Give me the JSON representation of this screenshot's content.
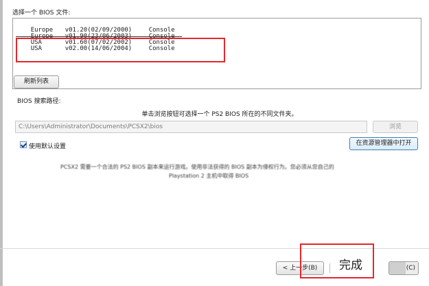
{
  "window": {
    "section_label": "选择一个 BIOS 文件:",
    "bios_list": [
      {
        "region": "Europe",
        "version": "v01.20(02/09/2000)",
        "type": "Console"
      },
      {
        "region": "Europe",
        "version": "v01.90(23/06/2003)",
        "type": "Console"
      },
      {
        "region": "USA",
        "version": "v01.60(07/02/2002)",
        "type": "Console"
      },
      {
        "region": "USA",
        "version": "v02.00(14/06/2004)",
        "type": "Console"
      }
    ],
    "refresh_button": "刷新列表",
    "search_path_label": "BIOS 搜索路径:",
    "browse_hint": "单击浏览按钮可选择一个 PS2 BIOS 所在的不同文件夹。",
    "path_value": "C:\\Users\\Administrator\\Documents\\PCSX2\\bios",
    "browse_button": "浏览",
    "use_default_label": "使用默认设置",
    "use_default_checked": true,
    "open_explorer_button": "在资源管理器中打开",
    "notice_line1": "PCSX2 需要一个合法的 PS2 BIOS 副本来运行游戏。使用非法获得的 BIOS 副本为侵权行为。您必须从您自己的",
    "notice_line2": "Playstation 2 主机中取得 BIOS"
  },
  "footer": {
    "back_button": "< 上一步(B)",
    "finish_label": "完成",
    "cancel_button": "(C)"
  },
  "colors": {
    "highlight": "#e3262c",
    "accent_button_border": "#3c7fb1"
  }
}
